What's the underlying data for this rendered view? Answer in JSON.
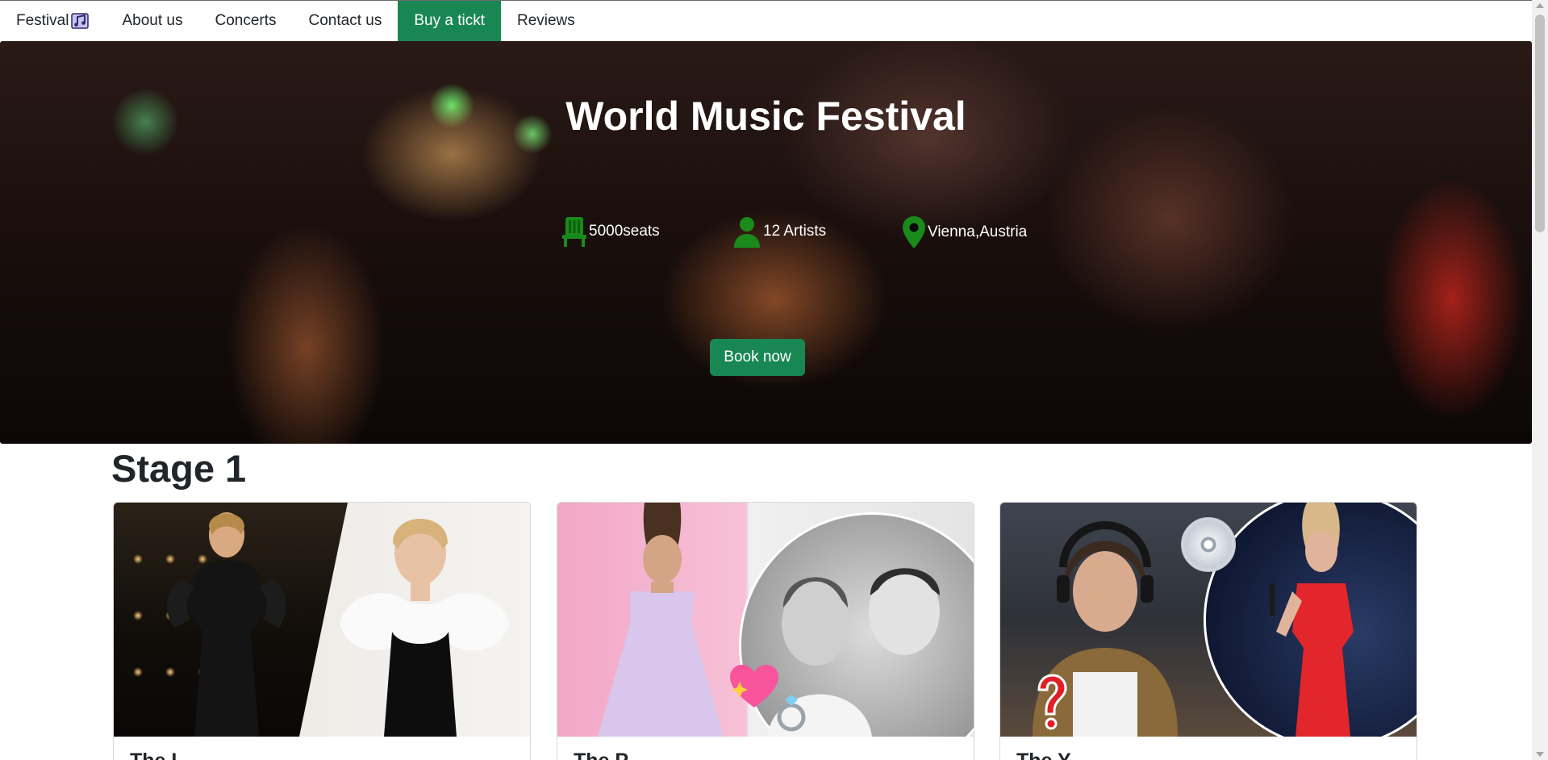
{
  "nav": {
    "brand": "Festival",
    "brand_icon": "music-note-icon",
    "items": [
      {
        "label": "About us"
      },
      {
        "label": "Concerts"
      },
      {
        "label": "Contact us"
      },
      {
        "label": "Buy a tickt",
        "active": true
      },
      {
        "label": "Reviews"
      }
    ]
  },
  "hero": {
    "title": "World Music Festival",
    "stats": [
      {
        "icon": "seat-icon",
        "text": "5000seats"
      },
      {
        "icon": "person-icon",
        "text": "12 Artists"
      },
      {
        "icon": "location-pin-icon",
        "text": "Vienna,Austria"
      }
    ],
    "book_button": "Book now"
  },
  "stage": {
    "title": "Stage 1",
    "cards": [
      {
        "title": "The L"
      },
      {
        "title": "The P"
      },
      {
        "title": "The Y"
      }
    ]
  },
  "colors": {
    "accent": "#198754",
    "icon_green": "#1a8a1a"
  }
}
